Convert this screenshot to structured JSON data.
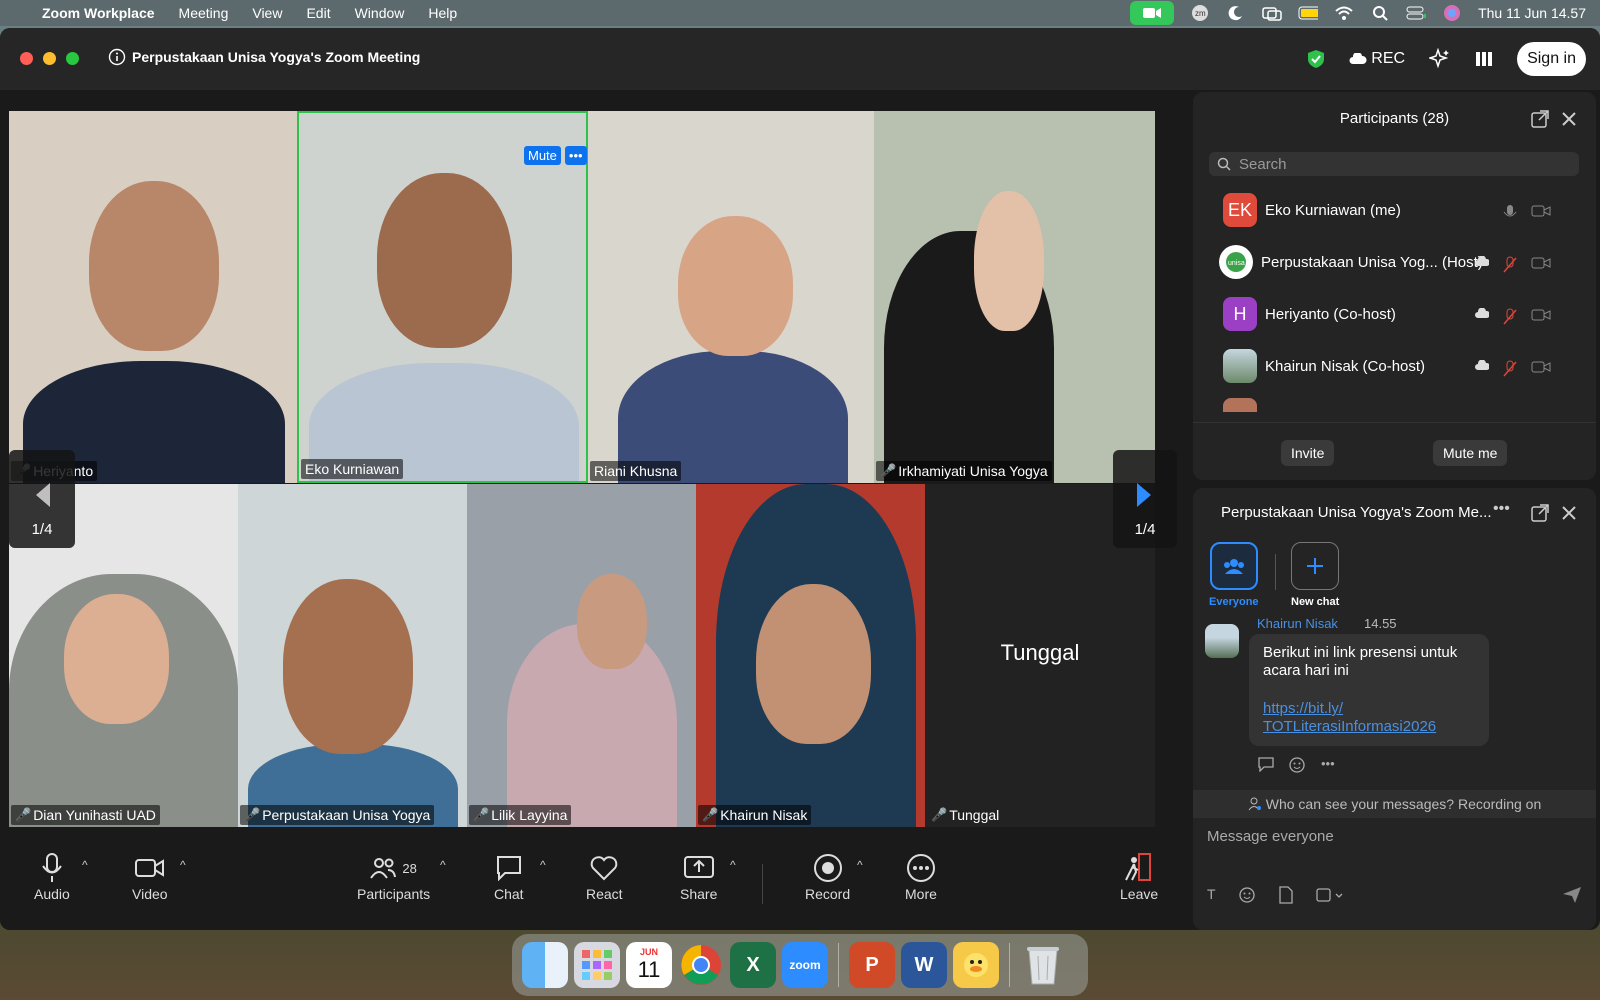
{
  "menubar": {
    "app_name": "Zoom Workplace",
    "items": [
      "Meeting",
      "View",
      "Edit",
      "Window",
      "Help"
    ],
    "datetime": "Thu 11 Jun  14.57",
    "status_icons": [
      "zoom-camera-icon",
      "zoom-icon",
      "moon-icon",
      "screen-mirror-icon",
      "battery-icon",
      "wifi-icon",
      "search-icon",
      "control-center-icon",
      "siri-icon"
    ]
  },
  "window": {
    "title": "Perpustakaan Unisa Yogya's Zoom Meeting",
    "rec_label": "REC",
    "sign_in": "Sign in"
  },
  "video_grid": {
    "page_left": "1/4",
    "page_right": "1/4",
    "mute_label": "Mute",
    "tiles": [
      {
        "name": "Heriyanto",
        "muted": true,
        "bg": "#d8cfc2",
        "skin": "#b88668",
        "cloth": "#1d2538"
      },
      {
        "name": "Eko Kurniawan",
        "muted": false,
        "active": true,
        "bg": "#cfd3d0",
        "skin": "#9c6a4d",
        "cloth": "#b9c5d3"
      },
      {
        "name": "Riani Khusna",
        "muted": false,
        "bg": "#d9d6cd",
        "skin": "#d8a486",
        "cloth": "#3c4c78"
      },
      {
        "name": "Irkhamiyati Unisa Yogya",
        "muted": true,
        "bg": "#b8c0b0",
        "skin": "#e3c0a8",
        "cloth": "#1a1a1a"
      },
      {
        "name": "Dian Yunihasti UAD",
        "muted": true,
        "bg": "#e6e6e6",
        "skin": "#dcae92",
        "cloth": "#8a8f8a"
      },
      {
        "name": "Perpustakaan Unisa Yogya",
        "muted": true,
        "bg": "#cfd6d8",
        "skin": "#a5704f",
        "cloth": "#3f6f96"
      },
      {
        "name": "Lilik Layyina",
        "muted": true,
        "bg": "#9aa0a8",
        "skin": "#c89a80",
        "cloth": "#c8a9b0"
      },
      {
        "name": "Khairun Nisak",
        "muted": true,
        "bg": "#b43a2e",
        "skin": "#c29072",
        "cloth": "#1d3a52"
      },
      {
        "name": "Tunggal",
        "muted": true,
        "bg": "#222222",
        "placeholder": "Tunggal"
      }
    ]
  },
  "toolbar": {
    "audio": "Audio",
    "video": "Video",
    "participants": "Participants",
    "participants_count": "28",
    "chat": "Chat",
    "react": "React",
    "share": "Share",
    "record": "Record",
    "more": "More",
    "leave": "Leave"
  },
  "participants_panel": {
    "title": "Participants (28)",
    "search_placeholder": "Search",
    "rows": [
      {
        "initials": "EK",
        "name": "Eko Kurniawan (me)",
        "avatar_color": "#e04a3a"
      },
      {
        "initials": "",
        "name": "Perpustakaan Unisa Yog...  (Host)",
        "avatar_color": "#ffffff"
      },
      {
        "initials": "H",
        "name": "Heriyanto (Co-host)",
        "avatar_color": "#9b3fc5"
      },
      {
        "initials": "",
        "name": "Khairun Nisak (Co-host)",
        "avatar_color": "#7f99a8"
      }
    ],
    "invite": "Invite",
    "mute_me": "Mute me"
  },
  "chat_panel": {
    "title": "Perpustakaan Unisa Yogya's Zoom Me...",
    "everyone": "Everyone",
    "new_chat": "New chat",
    "message": {
      "author": "Khairun Nisak",
      "time": "14.55",
      "text": "Berikut ini link presensi untuk acara hari ini",
      "link": "https://bit.ly/ TOTLiterasiInformasi2026"
    },
    "visibility_notice": "Who can see your messages? Recording on",
    "input_placeholder": "Message everyone"
  },
  "dock": {
    "calendar_month": "JUN",
    "calendar_day": "11",
    "zoom_label": "zoom"
  },
  "colors": {
    "accent": "#0e72ed",
    "active_border": "#2ec24b",
    "mute_red": "#e0453b"
  }
}
